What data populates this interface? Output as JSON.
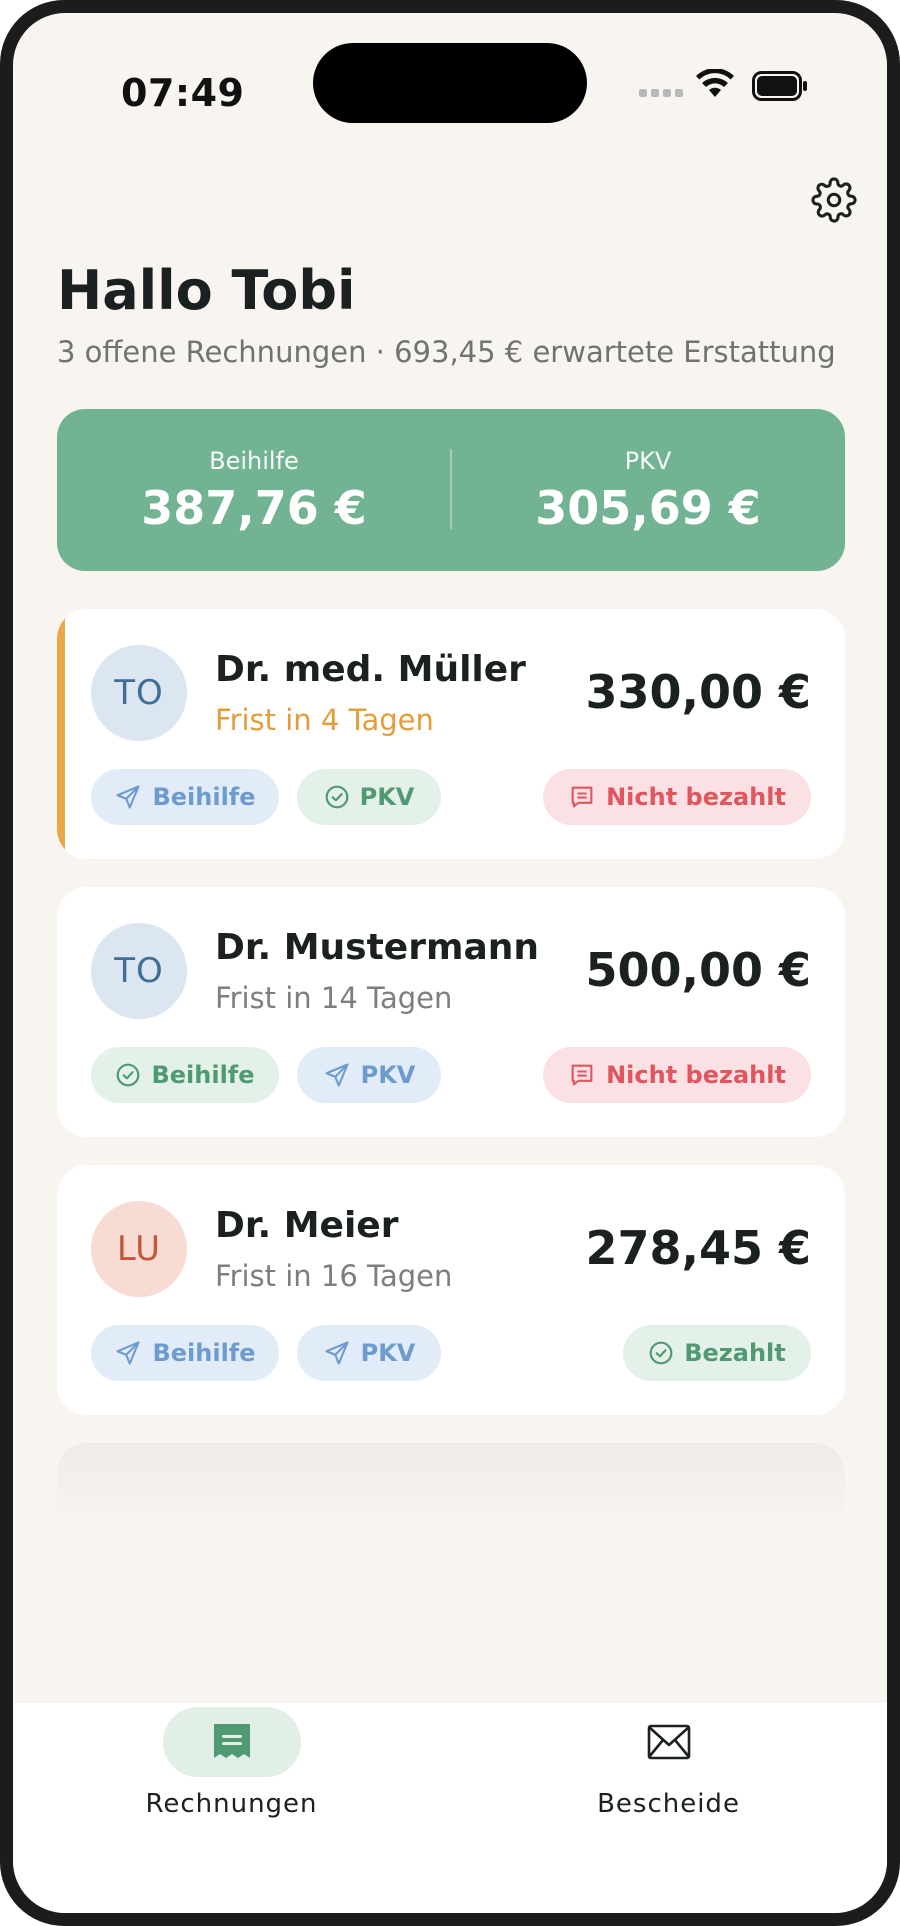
{
  "status_bar": {
    "time": "07:49"
  },
  "header": {
    "greeting": "Hallo Tobi",
    "summary": "3 offene Rechnungen · 693,45 € erwartete Erstattung"
  },
  "totals": {
    "left_label": "Beihilfe",
    "left_value": "387,76 €",
    "right_label": "PKV",
    "right_value": "305,69 €"
  },
  "invoices": [
    {
      "initials": "TO",
      "doctor": "Dr. med. Müller",
      "deadline": "Frist in 4 Tagen",
      "amount": "330,00 €",
      "beihilfe": {
        "label": "Beihilfe",
        "state": "sent",
        "icon": "paper-plane-icon"
      },
      "pkv": {
        "label": "PKV",
        "state": "done",
        "icon": "check-circle-icon"
      },
      "payment": {
        "label": "Nicht bezahlt",
        "state": "unpaid",
        "icon": "receipt-icon"
      }
    },
    {
      "initials": "TO",
      "doctor": "Dr. Mustermann",
      "deadline": "Frist in 14 Tagen",
      "amount": "500,00 €",
      "beihilfe": {
        "label": "Beihilfe",
        "state": "done",
        "icon": "check-circle-icon"
      },
      "pkv": {
        "label": "PKV",
        "state": "sent",
        "icon": "paper-plane-icon"
      },
      "payment": {
        "label": "Nicht bezahlt",
        "state": "unpaid",
        "icon": "receipt-icon"
      }
    },
    {
      "initials": "LU",
      "doctor": "Dr. Meier",
      "deadline": "Frist in 16 Tagen",
      "amount": "278,45 €",
      "beihilfe": {
        "label": "Beihilfe",
        "state": "sent",
        "icon": "paper-plane-icon"
      },
      "pkv": {
        "label": "PKV",
        "state": "sent",
        "icon": "paper-plane-icon"
      },
      "payment": {
        "label": "Bezahlt",
        "state": "paid",
        "icon": "check-circle-icon"
      }
    }
  ],
  "tabs": [
    {
      "label": "Rechnungen",
      "icon": "invoice-icon",
      "active": true
    },
    {
      "label": "Bescheide",
      "icon": "envelope-icon",
      "active": false
    }
  ],
  "colors": {
    "accent_green": "#71b393",
    "urgent_orange": "#e39e3c",
    "unpaid_red": "#e0565f",
    "sent_blue": "#6e9bcd",
    "background": "#f8f5f1"
  }
}
